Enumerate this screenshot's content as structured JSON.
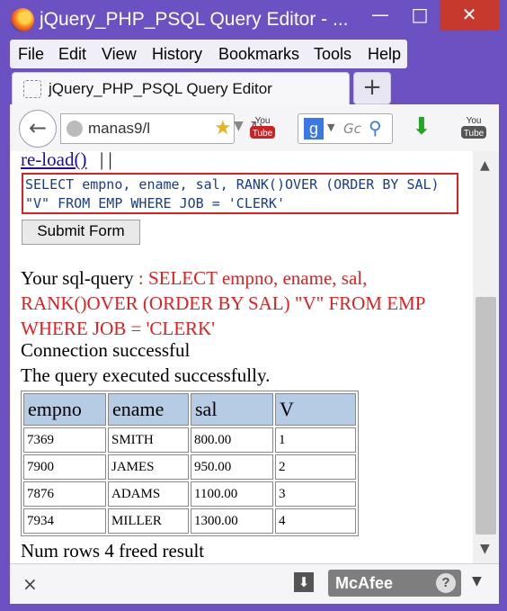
{
  "window": {
    "title": "jQuery_PHP_PSQL Query Editor - ...",
    "minimize": "—",
    "maximize": "□",
    "close": "✕"
  },
  "menubar": {
    "items": [
      "File",
      "Edit",
      "View",
      "History",
      "Bookmarks",
      "Tools",
      "Help"
    ]
  },
  "tab": {
    "label": "jQuery_PHP_PSQL Query Editor",
    "new_tab": "+"
  },
  "navbar": {
    "url": "manas9/l",
    "search_placeholder": "Gc",
    "back_icon": "←"
  },
  "page": {
    "reload_link": "re-load()",
    "separators": "| |",
    "sql_text": "SELECT empno, ename, sal, RANK()OVER (ORDER BY SAL) \"V\" FROM EMP WHERE JOB = 'CLERK'",
    "submit_label": "Submit Form",
    "sql_label": "Your sql-query",
    "sql_echo": " : SELECT empno, ename, sal, RANK()OVER (ORDER BY SAL) \"V\" FROM EMP WHERE JOB = 'CLERK'",
    "connection_msg": "Connection successful",
    "query_msg": "The query executed successfully.",
    "footer_msg": "Num rows 4 freed result"
  },
  "table": {
    "headers": [
      "empno",
      "ename",
      "sal",
      "V"
    ],
    "rows": [
      [
        "7369",
        "SMITH",
        "800.00",
        "1"
      ],
      [
        "7900",
        "JAMES",
        "950.00",
        "2"
      ],
      [
        "7876",
        "ADAMS",
        "1100.00",
        "3"
      ],
      [
        "7934",
        "MILLER",
        "1300.00",
        "4"
      ]
    ]
  },
  "bottombar": {
    "close": "×",
    "mcafee": "McAfee",
    "help": "?"
  }
}
